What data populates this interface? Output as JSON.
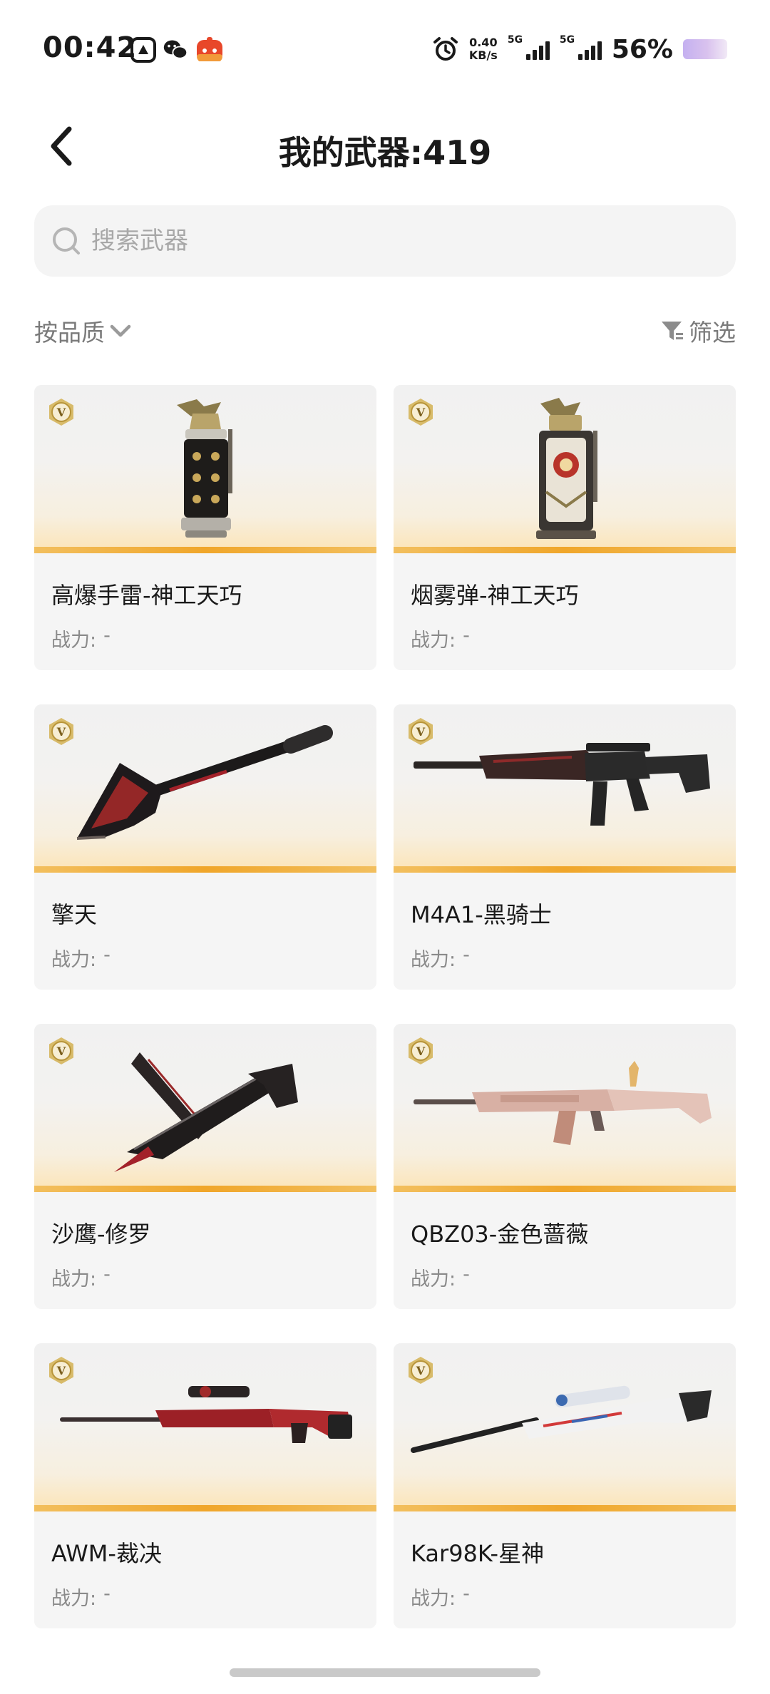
{
  "status_bar": {
    "time": "00:42",
    "net_speed_value": "0.40",
    "net_speed_unit": "KB/s",
    "sim1_type": "5G",
    "sim2_type": "5G",
    "battery": "56%"
  },
  "header": {
    "title": "我的武器:419"
  },
  "search": {
    "placeholder": "搜索武器"
  },
  "toolbar": {
    "sort_label": "按品质",
    "filter_label": "筛选"
  },
  "weapons": [
    {
      "name": "高爆手雷-神工天巧",
      "power_label": "战力:",
      "power_value": "-",
      "icon": "grenade-icon"
    },
    {
      "name": "烟雾弹-神工天巧",
      "power_label": "战力:",
      "power_value": "-",
      "icon": "smoke-grenade-icon"
    },
    {
      "name": "擎天",
      "power_label": "战力:",
      "power_value": "-",
      "icon": "shovel-melee-icon"
    },
    {
      "name": "M4A1-黑骑士",
      "power_label": "战力:",
      "power_value": "-",
      "icon": "assault-rifle-icon"
    },
    {
      "name": "沙鹰-修罗",
      "power_label": "战力:",
      "power_value": "-",
      "icon": "pistol-blade-icon"
    },
    {
      "name": "QBZ03-金色蔷薇",
      "power_label": "战力:",
      "power_value": "-",
      "icon": "rose-gold-rifle-icon"
    },
    {
      "name": "AWM-裁决",
      "power_label": "战力:",
      "power_value": "-",
      "icon": "sniper-rifle-red-icon"
    },
    {
      "name": "Kar98K-星神",
      "power_label": "战力:",
      "power_value": "-",
      "icon": "sniper-rifle-white-icon"
    }
  ],
  "badge_letter": "V",
  "colors": {
    "accent_gold": "#f0a62a",
    "badge_gold": "#c8a24a",
    "card_bg": "#f5f5f5",
    "muted_text": "#8a8a8a"
  }
}
